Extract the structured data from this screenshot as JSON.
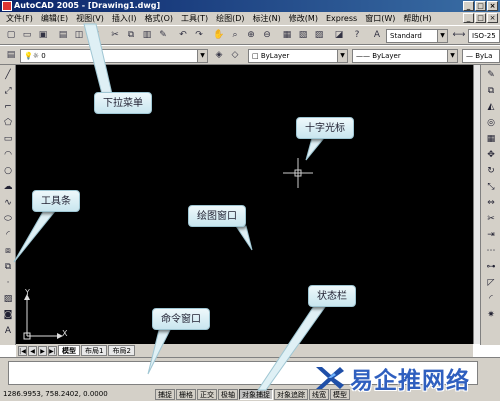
{
  "window": {
    "title": "AutoCAD 2005 - [Drawing1.dwg]"
  },
  "menu": [
    "文件(F)",
    "编辑(E)",
    "视图(V)",
    "插入(I)",
    "格式(O)",
    "工具(T)",
    "绘图(D)",
    "标注(N)",
    "修改(M)",
    "Express",
    "窗口(W)",
    "帮助(H)"
  ],
  "toolbar": {
    "text_style": "Standard",
    "dim_style": "ISO-25",
    "layer": "0",
    "color": "ByLayer",
    "linetype": "ByLayer",
    "lineweight": "ByLa"
  },
  "tabs": [
    "模型",
    "布局1",
    "布局2"
  ],
  "status": {
    "coords": "1286.9953, 758.2402, 0.0000",
    "buttons": [
      "捕捉",
      "栅格",
      "正交",
      "极轴",
      "对象捕捉",
      "对象追踪",
      "线宽",
      "模型"
    ]
  },
  "ucs": {
    "x_label": "X",
    "y_label": "Y"
  },
  "callouts": {
    "dropdown_menu": "下拉菜单",
    "crosshair": "十字光标",
    "toolbar": "工具条",
    "drawing_window": "绘图窗口",
    "status_bar": "状态栏",
    "command_window": "命令窗口"
  },
  "watermark": "易企推网络",
  "colors": {
    "canvas": "#000000",
    "title_bar": "#0a246a",
    "chrome": "#d4d0c8",
    "callout": "#c9e6ef"
  }
}
